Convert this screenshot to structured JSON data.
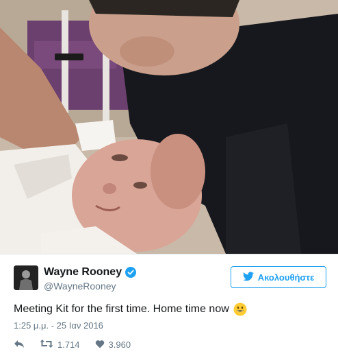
{
  "user": {
    "display_name": "Wayne Rooney",
    "handle": "@WayneRooney",
    "verified": true
  },
  "follow_button": {
    "label": "Ακολουθήστε",
    "icon": "twitter-bird-icon"
  },
  "tweet": {
    "text": "Meeting Kit for the first time. Home time now",
    "emoji": "grinning-face-icon",
    "timestamp": "1:25 μ.μ. - 25 Ιαν 2016"
  },
  "actions": {
    "reply_icon": "reply-icon",
    "retweet_icon": "retweet-icon",
    "retweet_count": "1.714",
    "like_icon": "heart-icon",
    "like_count": "3.960"
  },
  "colors": {
    "accent": "#1da1f2",
    "muted": "#657786",
    "text": "#14171a"
  }
}
